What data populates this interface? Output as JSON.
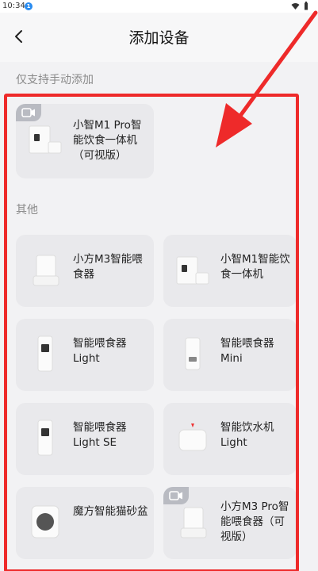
{
  "status": {
    "time": "10:34",
    "badge": "1"
  },
  "header": {
    "title": "添加设备"
  },
  "sections": {
    "manual_only": "仅支持手动添加",
    "others": "其他"
  },
  "devices": {
    "featured": {
      "name": "小智M1 Pro智能饮食一体机（可视版）"
    },
    "m3_feeder": {
      "name": "小方M3智能喂食器"
    },
    "m1_feeder": {
      "name": "小智M1智能饮食一体机"
    },
    "feeder_light": {
      "name": "智能喂食器 Light"
    },
    "feeder_mini": {
      "name": "智能喂食器 Mini"
    },
    "feeder_light_se": {
      "name": "智能喂食器 Light SE"
    },
    "fountain_light": {
      "name": "智能饮水机 Light"
    },
    "litter_box": {
      "name": "魔方智能猫砂盆"
    },
    "m3_pro_feeder": {
      "name": "小方M3 Pro智能喂食器（可视版）"
    }
  },
  "colors": {
    "highlight": "#ee2a2a",
    "card_bg": "#e9e9ec",
    "page_bg": "#f2f2f4"
  }
}
